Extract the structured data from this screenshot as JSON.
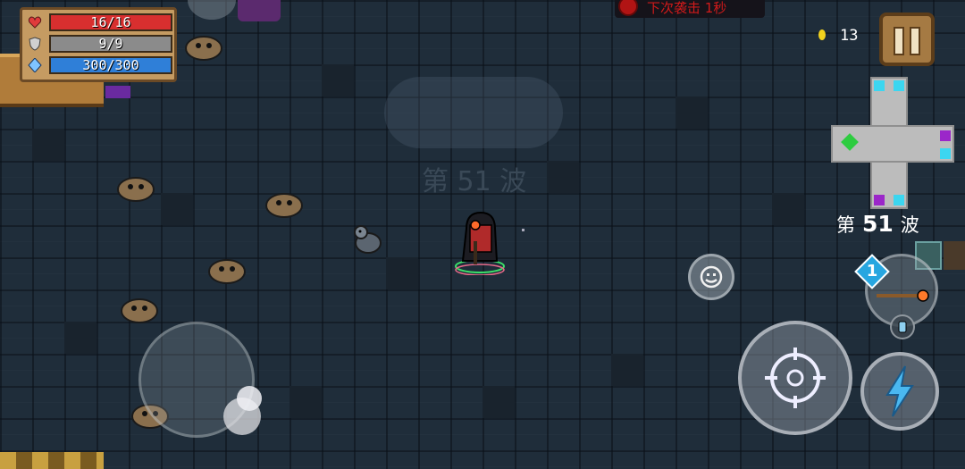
{
  "hud": {
    "hp": {
      "value": 16,
      "max": 16,
      "label": "16/16",
      "color": "#d82f2f"
    },
    "armor": {
      "value": 9,
      "max": 9,
      "label": "9/9",
      "color": "#8b8b8b"
    },
    "energy": {
      "value": 300,
      "max": 300,
      "label": "300/300",
      "color": "#2f7fd8"
    },
    "raid_banner": "下次袭击 1秒",
    "coins": "13",
    "pause_icon": "pause-icon"
  },
  "wave": {
    "center_text": "第 51 波",
    "side_prefix": "第",
    "side_number": "51",
    "side_suffix": "波"
  },
  "controls": {
    "weapon_badge": "1",
    "emote_icon": "smiley-face-icon",
    "attack_icon": "crosshair-icon",
    "skill_icon": "lightning-bolt-icon"
  },
  "colors": {
    "floor": "#1f2d3a",
    "panel": "#c59b62",
    "raid_text": "#d01a1a",
    "coin": "#f2d21e",
    "minimap_player": "#2ecc40",
    "minimap_portal": "#3cd6f0",
    "minimap_enemy": "#9b27c9"
  }
}
